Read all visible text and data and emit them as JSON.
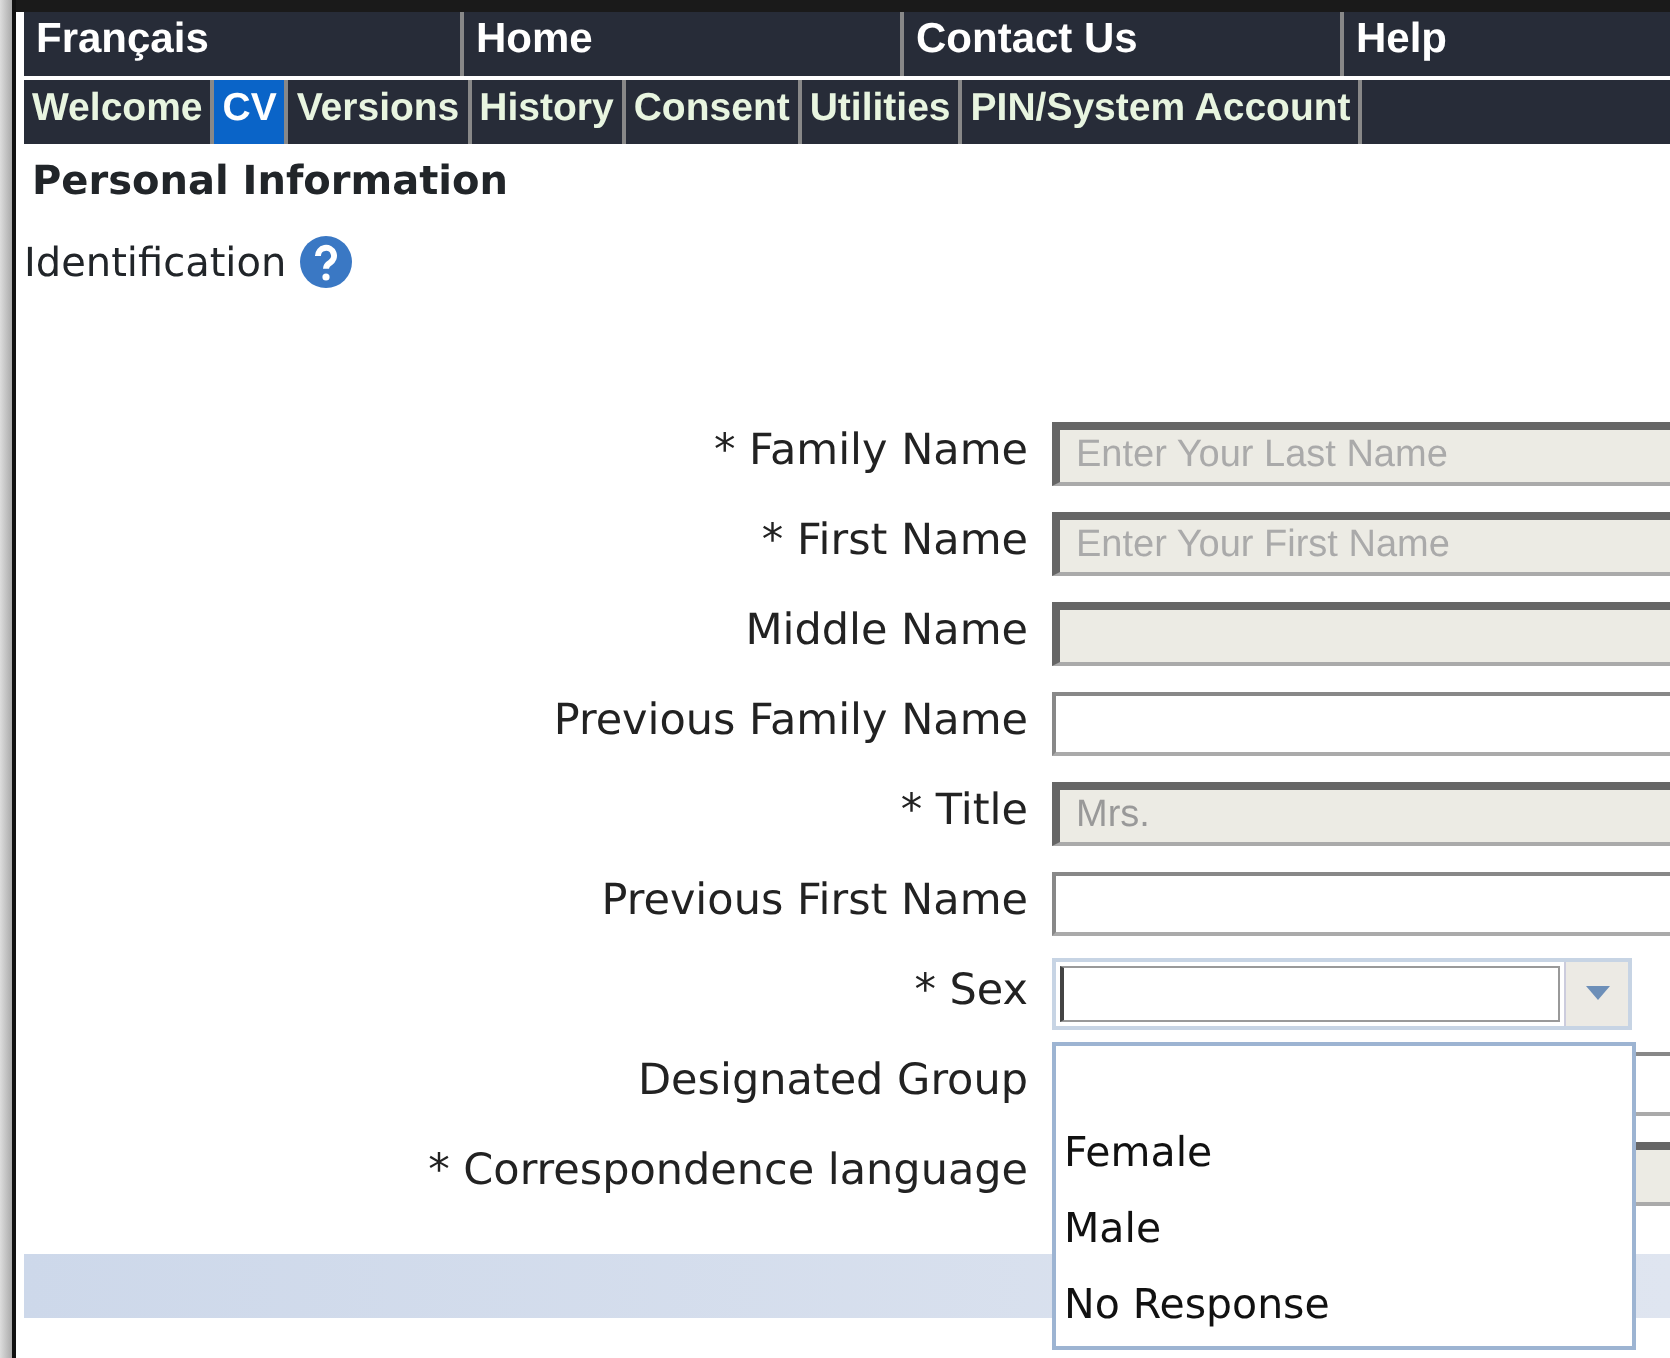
{
  "top_nav": [
    {
      "label": "Français"
    },
    {
      "label": "Home"
    },
    {
      "label": "Contact Us"
    },
    {
      "label": "Help"
    }
  ],
  "tabs": [
    {
      "label": "Welcome",
      "selected": false
    },
    {
      "label": "CV",
      "selected": true
    },
    {
      "label": "Versions",
      "selected": false
    },
    {
      "label": "History",
      "selected": false
    },
    {
      "label": "Consent",
      "selected": false
    },
    {
      "label": "Utilities",
      "selected": false
    },
    {
      "label": "PIN/System Account",
      "selected": false
    }
  ],
  "heading": "Personal Information",
  "section": {
    "title": "Identification"
  },
  "fields": [
    {
      "label": "* Family Name",
      "kind": "text",
      "disabled": true,
      "placeholder": "Enter Your Last Name"
    },
    {
      "label": "* First Name",
      "kind": "text",
      "disabled": true,
      "placeholder": "Enter Your First Name"
    },
    {
      "label": "Middle Name",
      "kind": "text",
      "disabled": true
    },
    {
      "label": "Previous Family Name",
      "kind": "text",
      "disabled": false
    },
    {
      "label": "* Title",
      "kind": "text",
      "disabled": true,
      "value": "Mrs."
    },
    {
      "label": "Previous First Name",
      "kind": "text",
      "disabled": false
    },
    {
      "label": "* Sex",
      "kind": "combo",
      "expanded": true,
      "options": [
        "Female",
        "Male",
        "No Response"
      ]
    },
    {
      "label": "Designated Group",
      "kind": "text",
      "disabled": false
    },
    {
      "label": "* Correspondence language",
      "kind": "text",
      "disabled": true
    }
  ]
}
